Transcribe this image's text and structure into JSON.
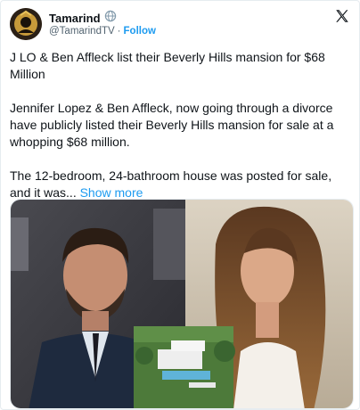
{
  "author": {
    "name": "Tamarind",
    "handle": "@TamarindTV",
    "separator": "·",
    "follow_label": "Follow"
  },
  "post": {
    "title": "J LO & Ben Affleck list their Beverly Hills mansion for $68 Million",
    "paragraph1": "Jennifer Lopez & Ben Affleck, now going through a divorce have publicly listed their Beverly Hills mansion for sale at a whopping $68 million.",
    "paragraph2_text": "The 12-bedroom, 24-bathroom house was posted for sale, and it was... ",
    "show_more_label": "Show more"
  },
  "colors": {
    "link": "#1d9bf0",
    "text": "#0f1419",
    "muted": "#536471"
  },
  "icons": [
    "avatar",
    "globe-icon",
    "x-logo-icon"
  ]
}
